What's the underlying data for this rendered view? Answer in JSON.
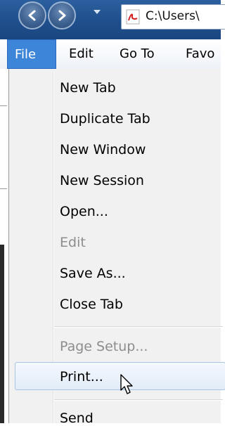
{
  "titlebar": {
    "back_icon": "back-arrow-icon",
    "forward_icon": "forward-arrow-icon",
    "address_icon": "pdf-icon",
    "address_text": "C:\\Users\\"
  },
  "menubar": {
    "items": [
      {
        "label": "File",
        "active": true
      },
      {
        "label": "Edit"
      },
      {
        "label": "Go To"
      },
      {
        "label": "Favo"
      }
    ]
  },
  "file_menu": {
    "items": [
      {
        "label": "New Tab",
        "enabled": true
      },
      {
        "label": "Duplicate Tab",
        "enabled": true
      },
      {
        "label": "New Window",
        "enabled": true
      },
      {
        "label": "New Session",
        "enabled": true
      },
      {
        "label": "Open...",
        "enabled": true
      },
      {
        "label": "Edit",
        "enabled": false
      },
      {
        "label": "Save As...",
        "enabled": true
      },
      {
        "label": "Close Tab",
        "enabled": true
      },
      {
        "label": "Page Setup...",
        "enabled": false
      },
      {
        "label": "Print...",
        "enabled": true,
        "highlighted": true
      },
      {
        "label": "Send",
        "enabled": true
      }
    ]
  },
  "colors": {
    "titlebar": "#1f4f8c",
    "menu_active": "#3c85d9",
    "menu_bg": "#f1f1f1",
    "disabled_text": "#8d8d8d"
  }
}
